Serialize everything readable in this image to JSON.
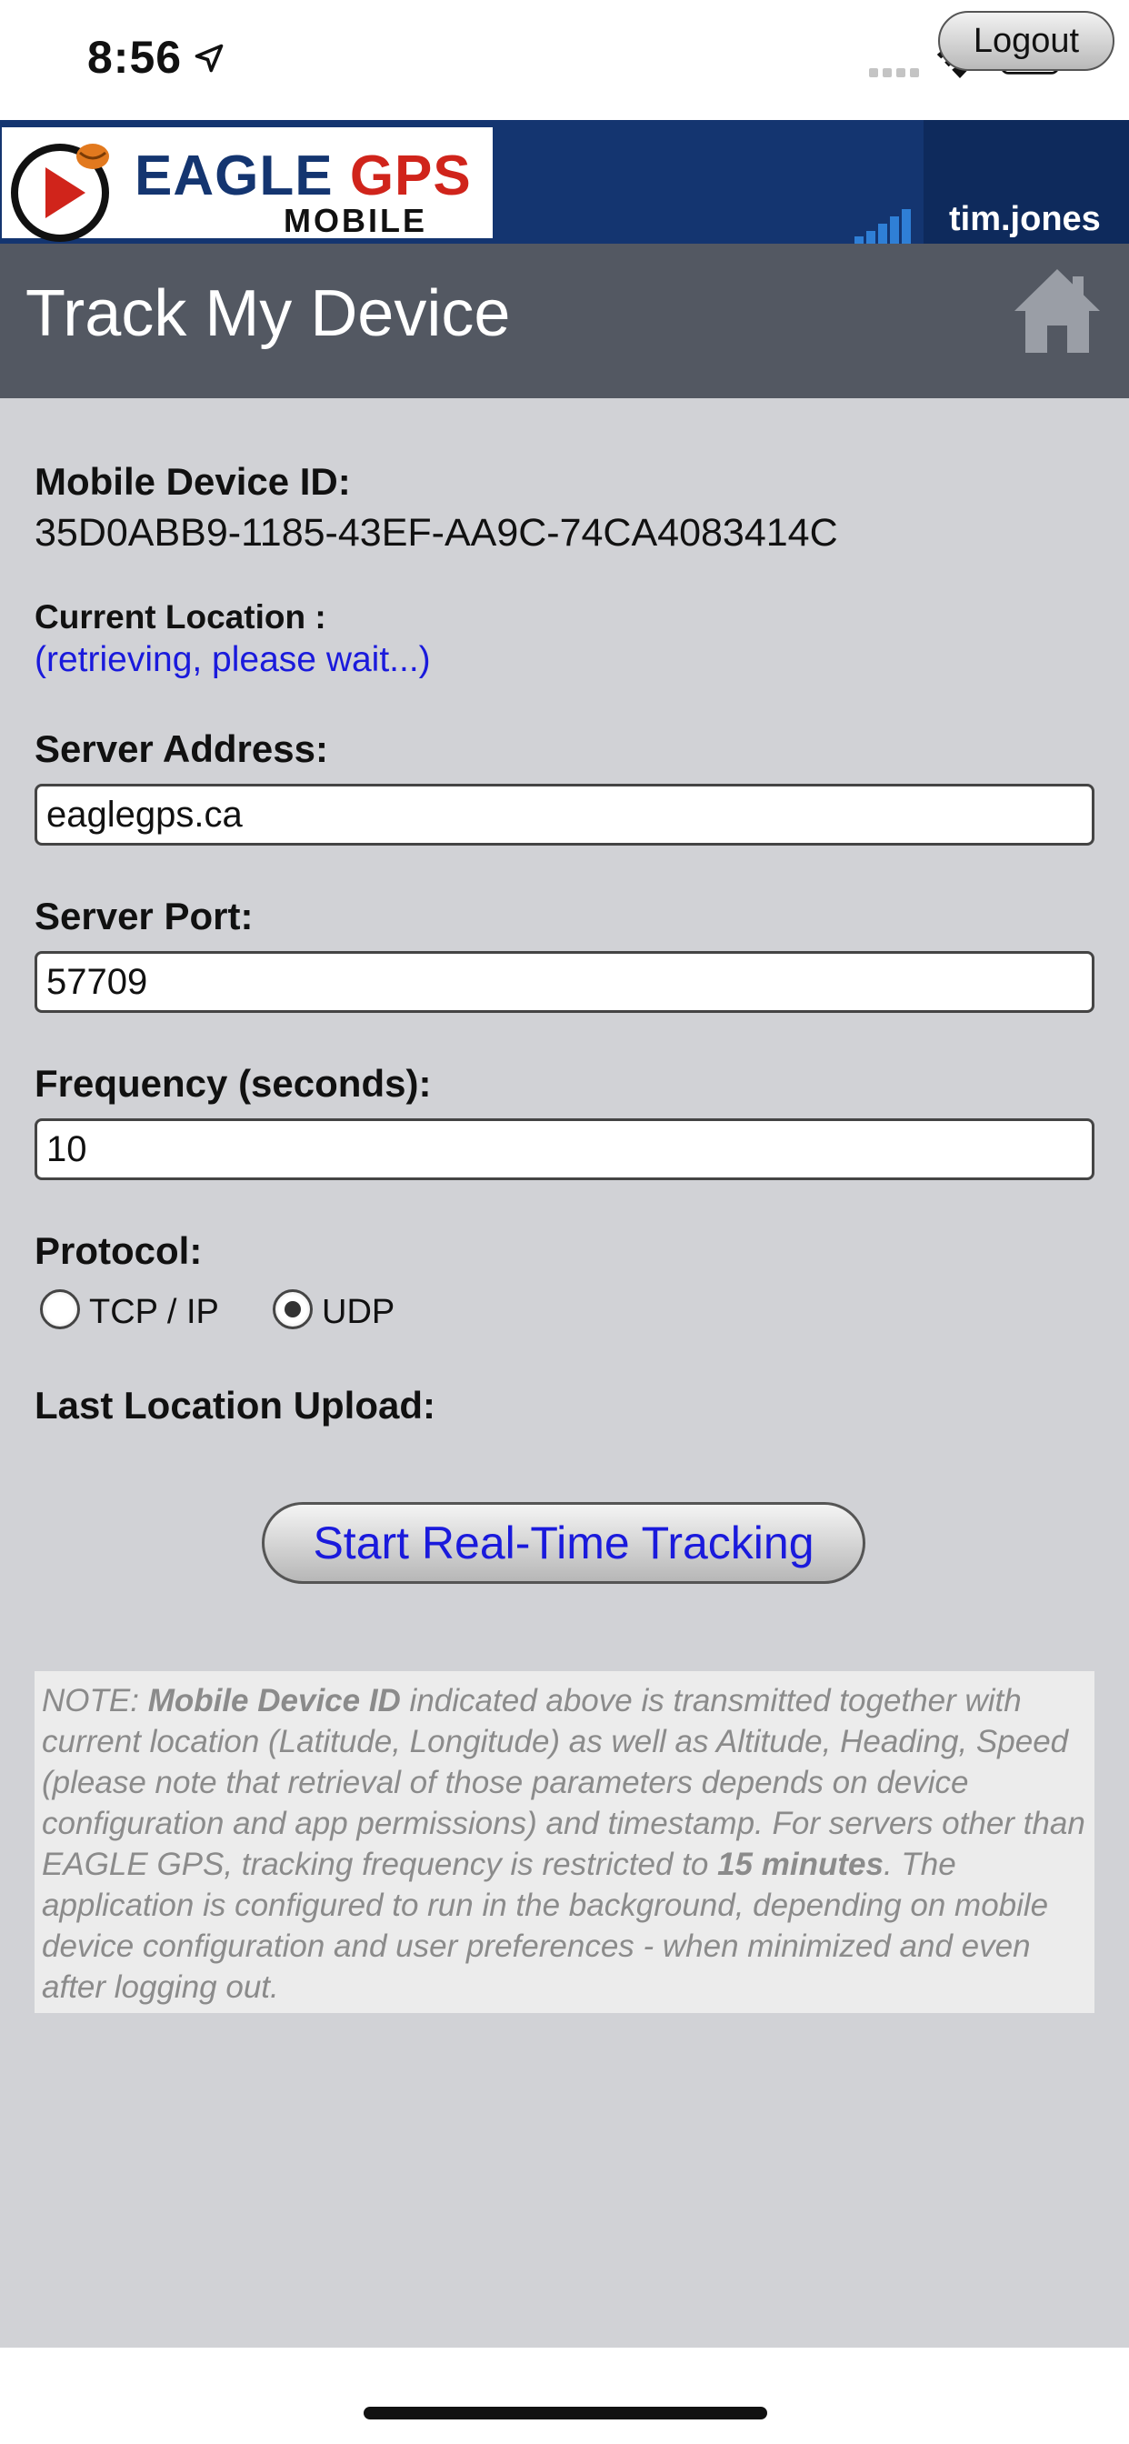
{
  "status": {
    "time": "8:56"
  },
  "header": {
    "logo_eagle": "EAGLE",
    "logo_gps": "GPS",
    "logo_mobile": "MOBILE",
    "logout_label": "Logout",
    "username": "tim.jones"
  },
  "titlebar": {
    "title": "Track My Device"
  },
  "device": {
    "id_label": "Mobile Device ID:",
    "id_value": "35D0ABB9-1185-43EF-AA9C-74CA4083414C"
  },
  "location": {
    "label": "Current Location :",
    "value": "(retrieving, please wait...)"
  },
  "form": {
    "server_address_label": "Server Address:",
    "server_address_value": "eaglegps.ca",
    "server_port_label": "Server Port:",
    "server_port_value": "57709",
    "frequency_label": "Frequency (seconds):",
    "frequency_value": "10",
    "protocol_label": "Protocol:",
    "protocol_options": [
      "TCP / IP",
      "UDP"
    ],
    "protocol_selected": "UDP",
    "last_upload_label": "Last Location Upload:"
  },
  "actions": {
    "start_tracking_label": "Start Real-Time Tracking"
  },
  "note": {
    "prefix": "NOTE: ",
    "bold_id": "Mobile Device ID",
    "part1": " indicated above is transmitted together with current location (Latitude, Longitude) as well as Altitude, Heading, Speed (please note that retrieval of those parameters depends on device configuration and app permissions) and timestamp. For servers other than EAGLE GPS, tracking frequency is restricted to ",
    "bold_freq": "15 minutes",
    "part2": ". The application is configured to run in the background, depending on mobile device configuration and user preferences - when minimized and even after logging out."
  },
  "colors": {
    "header_bg": "#143570",
    "titlebar_bg": "#535862",
    "content_bg": "#d1d2d6",
    "link_blue": "#1a1adc",
    "logo_red": "#d0241b"
  }
}
